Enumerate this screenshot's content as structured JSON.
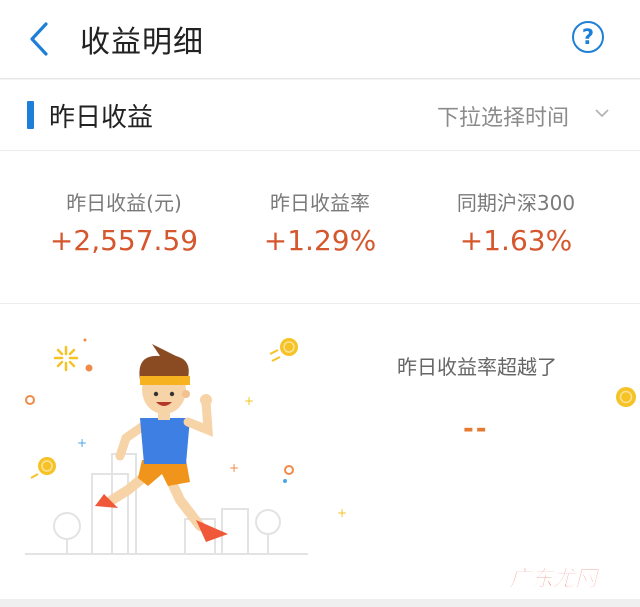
{
  "header": {
    "title": "收益明细"
  },
  "section": {
    "title": "昨日收益",
    "time_select_label": "下拉选择时间"
  },
  "stats": [
    {
      "label": "昨日收益(元)",
      "value": "+2,557.59"
    },
    {
      "label": "昨日收益率",
      "value": "+1.29%"
    },
    {
      "label": "同期沪深300",
      "value": "+1.63%"
    }
  ],
  "ranking": {
    "label": "昨日收益率超越了",
    "value": "--"
  },
  "watermark": {
    "text": "广东龙网"
  },
  "colors": {
    "accent_blue": "#1e7fd8",
    "positive_value": "#d4572d",
    "ranking_value": "#e77a32",
    "coin_yellow": "#f6c326",
    "runner_shirt": "#3d7fe2",
    "runner_shorts": "#f1941c"
  },
  "icons": {
    "back": "chevron-left-icon",
    "help": "question-circle-icon",
    "dropdown": "chevron-down-icon"
  }
}
